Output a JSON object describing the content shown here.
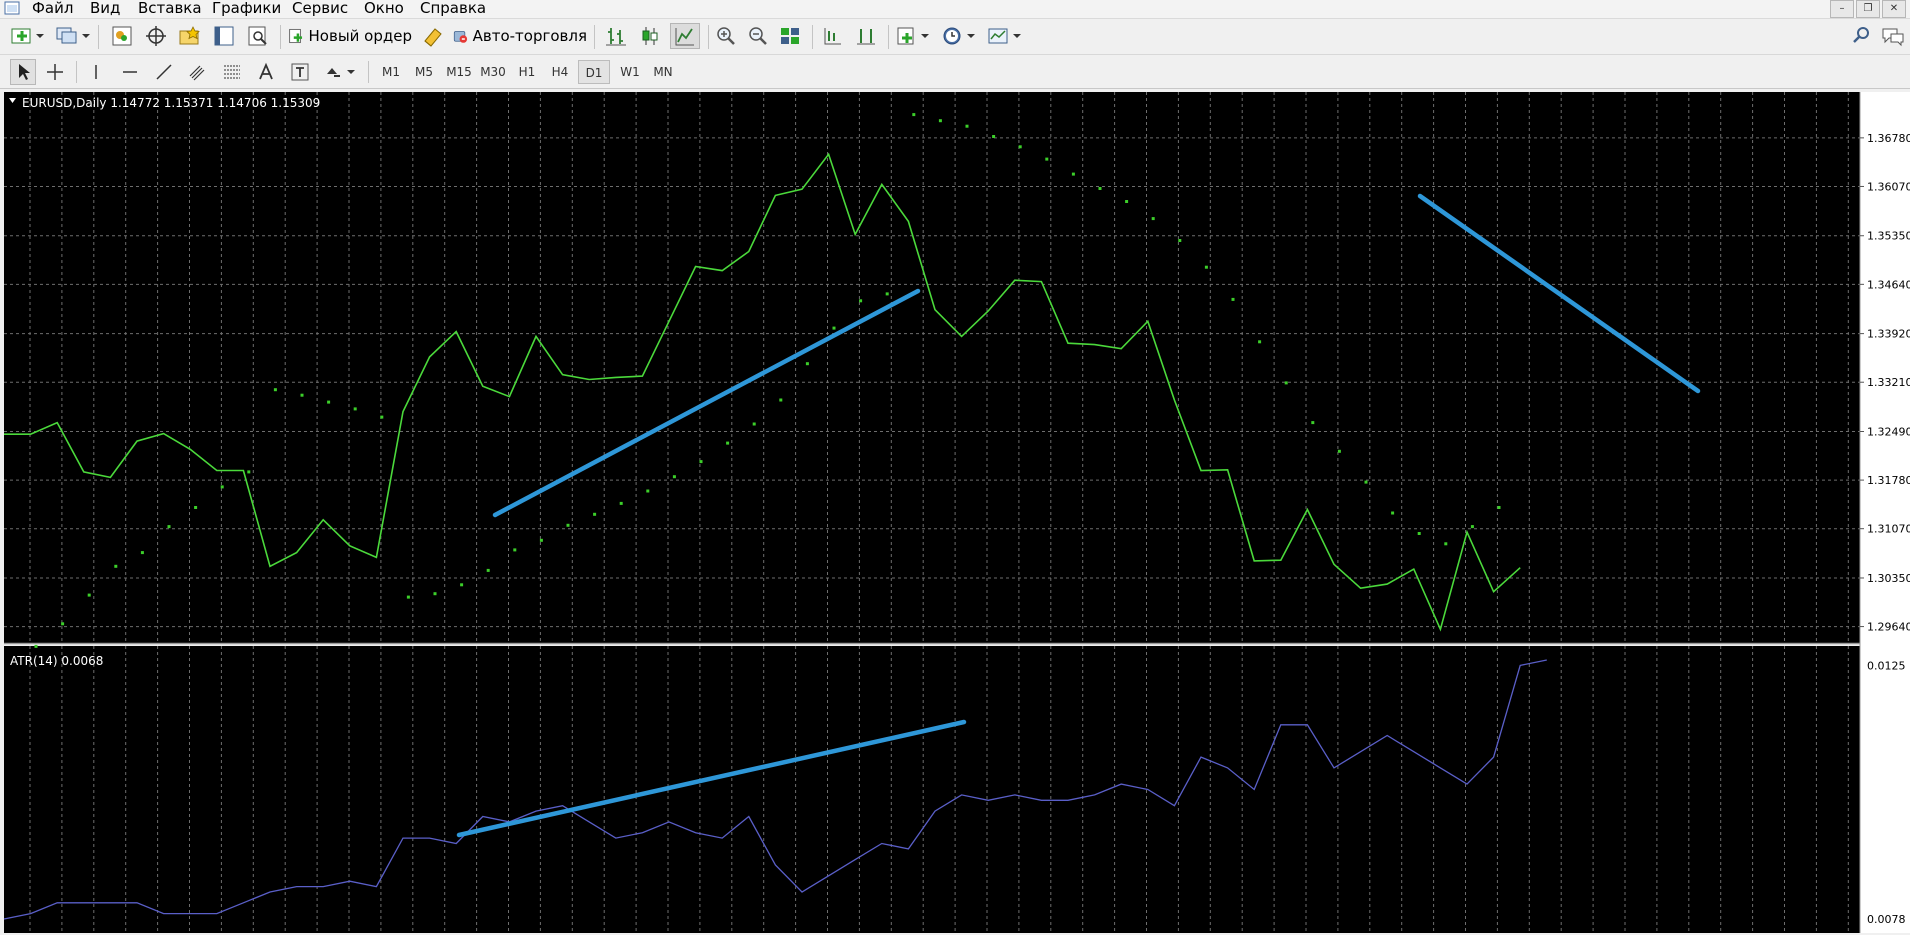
{
  "menu": {
    "items": [
      "Файл",
      "Вид",
      "Вставка",
      "Графики",
      "Сервис",
      "Окно",
      "Справка"
    ]
  },
  "toolbar": {
    "new_order_label": "Новый ордер",
    "autotrade_label": "Авто-торговля",
    "timeframes": [
      "M1",
      "M5",
      "M15",
      "M30",
      "H1",
      "H4",
      "D1",
      "W1",
      "MN"
    ],
    "active_timeframe": "D1"
  },
  "colors": {
    "chart_bg": "#000000",
    "price_line": "#4bd93b",
    "psar_dots": "#3ccf2a",
    "atr_line": "#5a5fc8",
    "trend_lines": "#2e97d8",
    "grid": "#6e6e6e"
  },
  "chart": {
    "symbol_info": "EURUSD,Daily  1.14772 1.15371 1.14706 1.15309",
    "atr_info": "ATR(14) 0.0068"
  },
  "chart_data": [
    {
      "type": "line",
      "title": "EURUSD,Daily",
      "ohlc": [
        "1.14772",
        "1.15371",
        "1.14706",
        "1.15309"
      ],
      "price_axis_ticks": [
        "1.36780",
        "1.36070",
        "1.35350",
        "1.34640",
        "1.33920",
        "1.33210",
        "1.32490",
        "1.31780",
        "1.31070",
        "1.30350",
        "1.29640"
      ],
      "ylim": [
        1.294,
        1.3745
      ],
      "series": [
        {
          "values": [
            1.3245,
            1.3245,
            1.3262,
            1.319,
            1.3182,
            1.3235,
            1.3246,
            1.3223,
            1.3192,
            1.3192,
            1.3052,
            1.3072,
            1.312,
            1.3082,
            1.3065,
            1.3278,
            1.3358,
            1.3395,
            1.3315,
            1.33,
            1.3388,
            1.3332,
            1.3325,
            1.3328,
            1.333,
            1.341,
            1.349,
            1.3484,
            1.3512,
            1.3594,
            1.3603,
            1.3654,
            1.3537,
            1.361,
            1.3556,
            1.3427,
            1.3388,
            1.3425,
            1.347,
            1.3468,
            1.3378,
            1.3376,
            1.337,
            1.341,
            1.3295,
            1.3192,
            1.3193,
            1.306,
            1.3061,
            1.3135,
            1.3055,
            1.302,
            1.3026,
            1.3048,
            1.296,
            1.3102,
            1.3015,
            1.305
          ]
        },
        {
          "name": "PSAR",
          "values": [
            1.2935,
            1.2968,
            1.301,
            1.3052,
            1.3072,
            1.311,
            1.3138,
            1.3168,
            1.319,
            1.331,
            1.3302,
            1.3292,
            1.3282,
            1.327,
            1.3007,
            1.3012,
            1.3025,
            1.3046,
            1.3076,
            1.309,
            1.3112,
            1.3128,
            1.3144,
            1.3162,
            1.3183,
            1.3205,
            1.3232,
            1.326,
            1.3295,
            1.3348,
            1.34,
            1.344,
            1.345,
            1.3712,
            1.3703,
            1.3695,
            1.368,
            1.3665,
            1.3647,
            1.3625,
            1.3604,
            1.3585,
            1.356,
            1.3528,
            1.3489,
            1.3442,
            1.338,
            1.332,
            1.3262,
            1.322,
            1.3175,
            1.313,
            1.31,
            1.3085,
            1.311,
            1.3138
          ]
        }
      ]
    },
    {
      "type": "line",
      "title": "ATR(14)",
      "current_value": "0.0068",
      "axis_ticks": [
        "0.0125",
        "0.0078"
      ],
      "ylim": [
        0.0078,
        0.0126
      ],
      "series": [
        {
          "name": "ATR(14)",
          "values": [
            0.0078,
            0.0079,
            0.0081,
            0.0081,
            0.0081,
            0.0081,
            0.0079,
            0.0079,
            0.0079,
            0.0081,
            0.0083,
            0.0084,
            0.0084,
            0.0085,
            0.0084,
            0.0093,
            0.0093,
            0.0092,
            0.0097,
            0.0096,
            0.0098,
            0.0099,
            0.0096,
            0.0093,
            0.0094,
            0.0096,
            0.0094,
            0.0093,
            0.0097,
            0.0088,
            0.0083,
            0.0086,
            0.0089,
            0.0092,
            0.0091,
            0.0098,
            0.0101,
            0.01,
            0.0101,
            0.01,
            0.01,
            0.0101,
            0.0103,
            0.0102,
            0.0099,
            0.0108,
            0.0106,
            0.0102,
            0.0114,
            0.0114,
            0.0106,
            0.0109,
            0.0112,
            0.0109,
            0.0106,
            0.0103,
            0.0108,
            0.0125,
            0.0126
          ]
        }
      ]
    }
  ]
}
